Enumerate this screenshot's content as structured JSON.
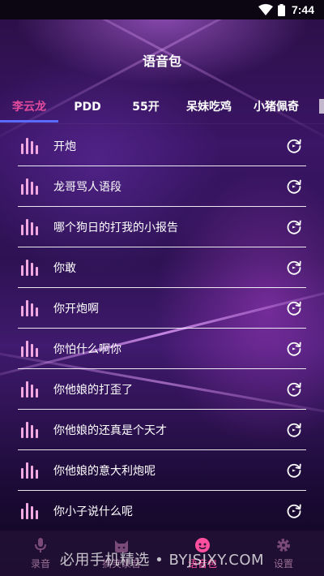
{
  "status_bar": {
    "time": "7:44"
  },
  "header": {
    "title": "语音包"
  },
  "tabs": [
    {
      "label": "李云龙",
      "active": true
    },
    {
      "label": "PDD",
      "active": false
    },
    {
      "label": "55开",
      "active": false
    },
    {
      "label": "呆妹吃鸡",
      "active": false
    },
    {
      "label": "小猪佩奇",
      "active": false
    }
  ],
  "list": {
    "items": [
      {
        "label": "开炮"
      },
      {
        "label": "龙哥骂人语段"
      },
      {
        "label": "哪个狗日的打我的小报告"
      },
      {
        "label": "你敢"
      },
      {
        "label": "你开炮啊"
      },
      {
        "label": "你怕什么啊你"
      },
      {
        "label": "你他娘的打歪了"
      },
      {
        "label": "你他娘的还真是个天才"
      },
      {
        "label": "你他娘的意大利炮呢"
      },
      {
        "label": "你小子说什么呢"
      }
    ],
    "icons": {
      "leading": "audio-bars-icon",
      "trailing": "replay-icon"
    }
  },
  "bottom_nav": [
    {
      "label": "录音",
      "icon": "microphone-icon",
      "active": false
    },
    {
      "label": "搞笑录音",
      "icon": "cat-icon",
      "active": false
    },
    {
      "label": "语音包",
      "icon": "smiley-icon",
      "active": true
    },
    {
      "label": "设置",
      "icon": "gear-icon",
      "active": false
    }
  ],
  "watermark": {
    "text": "必用手机精选 • BYJSJXY.COM"
  },
  "colors": {
    "accent_pink": "#e24b9c",
    "indicator_blue": "#5a6cff",
    "nav_active": "#ff4f9e"
  }
}
